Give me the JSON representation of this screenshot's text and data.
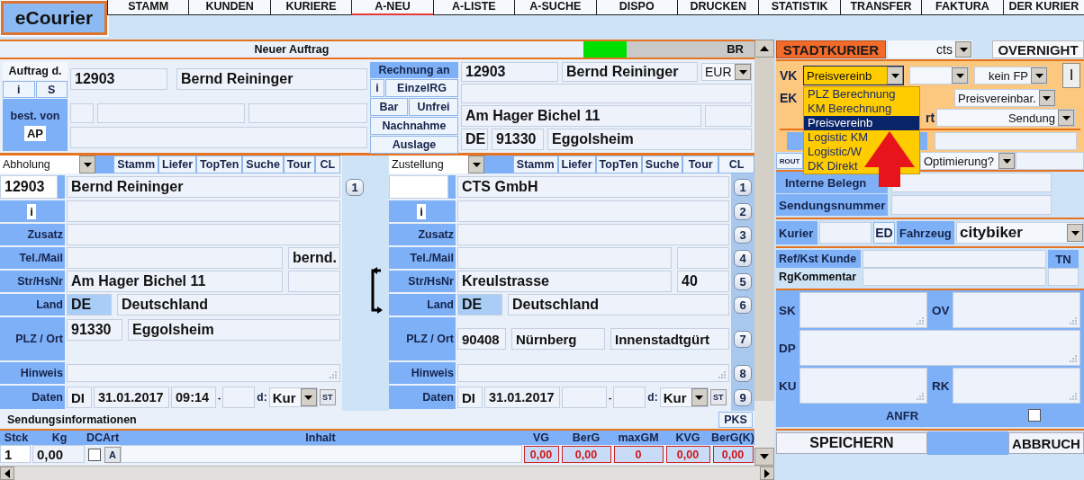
{
  "logo": "eCourier",
  "nav": [
    {
      "label": "STAMM",
      "selected": false
    },
    {
      "label": "KUNDEN",
      "selected": false
    },
    {
      "label": "KURIERE",
      "selected": false
    },
    {
      "label": "A-NEU",
      "selected": true
    },
    {
      "label": "A-LISTE",
      "selected": false
    },
    {
      "label": "A-SUCHE",
      "selected": false
    },
    {
      "label": "DISPO",
      "selected": false
    },
    {
      "label": "DRUCKEN",
      "selected": false
    },
    {
      "label": "STATISTIK",
      "selected": false
    },
    {
      "label": "TRANSFER",
      "selected": false
    },
    {
      "label": "FAKTURA",
      "selected": false
    },
    {
      "label": "DER KURIER",
      "selected": false
    }
  ],
  "order": {
    "title": "Neuer Auftrag",
    "status": {
      "level": 0.25,
      "label": "BR"
    }
  },
  "header": {
    "ordered_by_label": "Auftrag d.",
    "ordered_by_buttons": [
      "i",
      "S"
    ],
    "customer_number": "12903",
    "customer_name": "Bernd Reininger",
    "requested_by_label": "best. von",
    "requested_by_button": "AP",
    "invoice_label": "Rechnung an",
    "invoice_buttons": [
      [
        "i",
        "EinzelRG"
      ],
      [
        "Bar",
        "Unfrei"
      ],
      [
        "Nachnahme"
      ],
      [
        "Auslage"
      ]
    ],
    "invoice_number": "12903",
    "invoice_name": "Bernd Reininger",
    "currency": "EUR",
    "invoice_street": "Am Hager Bichel 11",
    "invoice_country": "DE",
    "invoice_zip": "91330",
    "invoice_city": "Eggolsheim"
  },
  "addresses": [
    {
      "kind": "pickup",
      "type": "Abholung",
      "tools": [
        "Stamm",
        "Liefer",
        "TopTen",
        "Suche",
        "Tour",
        "CL"
      ],
      "number": "12903",
      "name": "Bernd Reininger",
      "info": "i",
      "labels": [
        "Zusatz",
        "Tel./Mail",
        "Str/HsNr",
        "Land",
        "PLZ / Ort",
        "Hinweis",
        "Daten"
      ],
      "mail": "bernd.",
      "street": "Am Hager Bichel 11",
      "country_code": "DE",
      "country": "Deutschland",
      "zip": "91330",
      "city": "Eggolsheim",
      "day": "DI",
      "date": "31.01.2017",
      "time_from": "09:14",
      "dash": "-",
      "d_label": "d:",
      "type_select": "Kur",
      "st": "ST",
      "line_numbers": [
        "1"
      ]
    },
    {
      "kind": "delivery",
      "type": "Zustellung",
      "tools": [
        "Stamm",
        "Liefer",
        "TopTen",
        "Suche",
        "Tour",
        "CL"
      ],
      "name": "CTS GmbH",
      "info": "i",
      "labels": [
        "Zusatz",
        "Tel./Mail",
        "Str/HsNr",
        "Land",
        "PLZ / Ort",
        "Hinweis",
        "Daten"
      ],
      "street": "Kreulstrasse",
      "house_no": "40",
      "country_code": "DE",
      "country": "Deutschland",
      "zip": "90408",
      "city": "Nürnberg",
      "district": "Innenstadtgürt",
      "day": "DI",
      "date": "31.01.2017",
      "dash": "-",
      "d_label": "d:",
      "type_select": "Kur",
      "st": "ST",
      "line_numbers": [
        "1",
        "2",
        "3",
        "4",
        "5",
        "6",
        "7",
        "8",
        "9"
      ]
    }
  ],
  "shipment": {
    "title": "Sendungsinformationen",
    "pks": "PKS",
    "columns": [
      "Stck",
      "Kg",
      "DC",
      "Art",
      "Inhalt",
      "VG",
      "BerG",
      "maxGM",
      "KVG",
      "BerG(K)"
    ],
    "quantity": "1",
    "weight": "0,00",
    "dc_checked": false,
    "art_button": "A",
    "totals": [
      "0,00",
      "0,00",
      "0",
      "0,00",
      "0,00"
    ]
  },
  "service": {
    "tabs": [
      {
        "label": "STADTKURIER",
        "selected": true
      },
      {
        "label": "OVERNIGHT",
        "selected": false
      }
    ],
    "select": "cts"
  },
  "pricing": {
    "vk_label": "VK",
    "vk_select": "Preisvereinb",
    "fp_select": "kein FP",
    "info_button": "I",
    "ek_label": "EK",
    "ek_select": "Preisvereinbar.",
    "rt_label": "rt",
    "unit_select": "Sendung",
    "route_button": "ROUT",
    "optimize_select": "Optimierung?"
  },
  "price_menu": [
    {
      "label": "PLZ Berechnung",
      "selected": false
    },
    {
      "label": "KM Berechnung",
      "selected": false
    },
    {
      "label": "Preisvereinb",
      "selected": true
    },
    {
      "label": "Logistic KM",
      "selected": false
    },
    {
      "label": "Logistic/W",
      "selected": false
    },
    {
      "label": "DK Direkt",
      "selected": false
    }
  ],
  "details": {
    "internal_label": "Interne Belegn",
    "shipment_label": "Sendungsnummer",
    "courier_label": "Kurier",
    "ed_button": "ED",
    "vehicle_label": "Fahrzeug",
    "vehicle": "citybiker",
    "ref_label": "Ref/Kst Kunde",
    "tn_label": "TN",
    "comment_label": "RgKommentar",
    "notes": [
      [
        "SK",
        "OV"
      ],
      [
        "DP"
      ],
      [
        "KU",
        "RK"
      ]
    ],
    "anfr_label": "ANFR",
    "anfr_checked": false
  },
  "actions": [
    "SPEICHERN",
    "ABBRUCH"
  ]
}
